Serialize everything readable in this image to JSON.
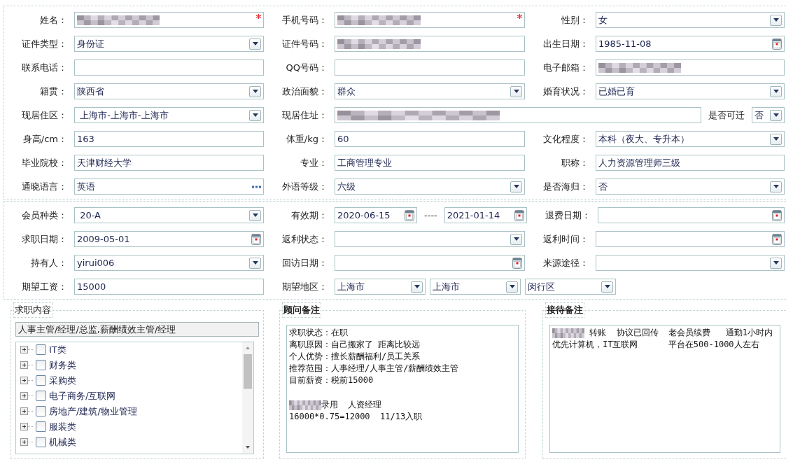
{
  "sections": [
    {
      "rows": [
        [
          {
            "label": "姓名：",
            "fields": [
              {
                "kind": "input",
                "required": true,
                "redacted": true
              }
            ]
          },
          {
            "label": "手机号码：",
            "fields": [
              {
                "kind": "input",
                "required": true,
                "redacted": true
              }
            ]
          },
          {
            "label": "性别：",
            "fields": [
              {
                "kind": "select",
                "value": "女"
              }
            ]
          }
        ],
        [
          {
            "label": "证件类型：",
            "fields": [
              {
                "kind": "select",
                "value": "身份证"
              }
            ]
          },
          {
            "label": "证件号码：",
            "fields": [
              {
                "kind": "input",
                "redacted": true
              }
            ]
          },
          {
            "label": "出生日期：",
            "fields": [
              {
                "kind": "date",
                "value": "1985-11-08"
              }
            ]
          }
        ],
        [
          {
            "label": "联系电话：",
            "fields": [
              {
                "kind": "input"
              }
            ]
          },
          {
            "label": "QQ号码：",
            "fields": [
              {
                "kind": "input"
              }
            ]
          },
          {
            "label": "电子邮箱：",
            "fields": [
              {
                "kind": "input",
                "redacted": true
              }
            ]
          }
        ],
        [
          {
            "label": "籍贯：",
            "fields": [
              {
                "kind": "select",
                "value": "陕西省"
              }
            ]
          },
          {
            "label": "政治面貌：",
            "fields": [
              {
                "kind": "select",
                "value": "群众"
              }
            ]
          },
          {
            "label": "婚育状况：",
            "fields": [
              {
                "kind": "select",
                "value": "已婚已育"
              }
            ]
          }
        ],
        [
          {
            "label": "现居住区：",
            "fields": [
              {
                "kind": "select",
                "value": " 上海市-上海市-上海市"
              }
            ]
          },
          {
            "label": "现居住址：",
            "fields": [
              {
                "kind": "input",
                "redacted": true
              },
              {
                "kind": "label",
                "text": "是否可迁"
              },
              {
                "kind": "select",
                "value": "否"
              }
            ]
          }
        ],
        [
          {
            "label": "身高/cm：",
            "fields": [
              {
                "kind": "input",
                "value": "163"
              }
            ]
          },
          {
            "label": "体重/kg：",
            "fields": [
              {
                "kind": "input",
                "value": "60"
              }
            ]
          },
          {
            "label": "文化程度：",
            "fields": [
              {
                "kind": "select",
                "value": "本科（夜大、专升本）"
              }
            ]
          }
        ],
        [
          {
            "label": "毕业院校：",
            "fields": [
              {
                "kind": "input",
                "value": "天津财经大学"
              }
            ]
          },
          {
            "label": "专业：",
            "fields": [
              {
                "kind": "input",
                "value": "工商管理专业"
              }
            ]
          },
          {
            "label": "职称：",
            "fields": [
              {
                "kind": "input",
                "value": "人力资源管理师三级"
              }
            ]
          }
        ],
        [
          {
            "label": "通晓语言：",
            "fields": [
              {
                "kind": "picker",
                "value": "英语"
              }
            ]
          },
          {
            "label": "外语等级：",
            "fields": [
              {
                "kind": "select",
                "value": "六级"
              }
            ]
          },
          {
            "label": "是否海归：",
            "fields": [
              {
                "kind": "select",
                "value": "否"
              }
            ]
          }
        ]
      ]
    },
    {
      "rows": [
        [
          {
            "label": "会员种类：",
            "fields": [
              {
                "kind": "select",
                "value": " 20-A"
              }
            ]
          },
          {
            "label": "有效期：",
            "fields": [
              {
                "kind": "date",
                "value": "2020-06-15"
              },
              {
                "kind": "label",
                "text": "----"
              },
              {
                "kind": "date",
                "value": "2021-01-14"
              }
            ]
          },
          {
            "label": "退费日期：",
            "fields": [
              {
                "kind": "date"
              }
            ]
          }
        ],
        [
          {
            "label": "求职日期：",
            "fields": [
              {
                "kind": "date",
                "value": "2009-05-01"
              }
            ]
          },
          {
            "label": "返利状态：",
            "fields": [
              {
                "kind": "select"
              }
            ]
          },
          {
            "label": "返利时间：",
            "fields": [
              {
                "kind": "date"
              }
            ]
          }
        ],
        [
          {
            "label": "持有人：",
            "fields": [
              {
                "kind": "select",
                "value": "yirui006"
              }
            ]
          },
          {
            "label": "回访日期：",
            "fields": [
              {
                "kind": "date"
              }
            ]
          },
          {
            "label": "来源途径：",
            "fields": [
              {
                "kind": "select"
              }
            ]
          }
        ],
        [
          {
            "label": "期望工资：",
            "fields": [
              {
                "kind": "input",
                "value": "15000"
              }
            ]
          },
          {
            "label": "期望地区：",
            "fields": [
              {
                "kind": "select",
                "value": "上海市"
              },
              {
                "kind": "select",
                "value": "上海市"
              },
              {
                "kind": "select",
                "value": "闵行区"
              }
            ]
          }
        ]
      ]
    }
  ],
  "panels": [
    {
      "kind": "tree",
      "title": "求职内容",
      "bold_title": false,
      "summary": "人事主管/经理/总监,薪酬绩效主管/经理",
      "items": [
        {
          "label": "IT类",
          "expanded": false,
          "checked": false
        },
        {
          "label": "财务类",
          "expanded": false,
          "checked": false
        },
        {
          "label": "采购类",
          "expanded": false,
          "checked": false
        },
        {
          "label": "电子商务/互联网",
          "expanded": false,
          "checked": false
        },
        {
          "label": "房地产/建筑/物业管理",
          "expanded": false,
          "checked": false
        },
        {
          "label": "服装类",
          "expanded": false,
          "checked": false
        },
        {
          "label": "机械类",
          "expanded": false,
          "checked": false
        }
      ]
    },
    {
      "kind": "notes",
      "title": "顾问备注",
      "bold_title": true,
      "paragraphs": [
        [
          {
            "text": "求职状态：在职",
            "redacted": false
          },
          {
            "text": "离职原因：自己搬家了 距离比较远",
            "redacted": false
          },
          {
            "text": "个人优势：擅长薪酬福利/员工关系",
            "redacted": false
          },
          {
            "text": "推荐范围：人事经理/人事主管/薪酬绩效主管",
            "redacted": false
          },
          {
            "text": "目前薪资：税前15000",
            "redacted": false
          }
        ],
        [
          {
            "text": "录用  人资经理",
            "redacted": true
          },
          {
            "text": "16000*0.75=12000  11/13入职",
            "redacted": false
          }
        ]
      ]
    },
    {
      "kind": "notes",
      "title": "接待备注",
      "bold_title": true,
      "paragraphs": [
        [
          {
            "text": " 转账  协议已回传  老会员续费   通勤1小时内",
            "redacted": true
          },
          {
            "text": "优先计算机，IT互联网      平台在500-1000人左右",
            "redacted": false
          }
        ]
      ]
    }
  ]
}
